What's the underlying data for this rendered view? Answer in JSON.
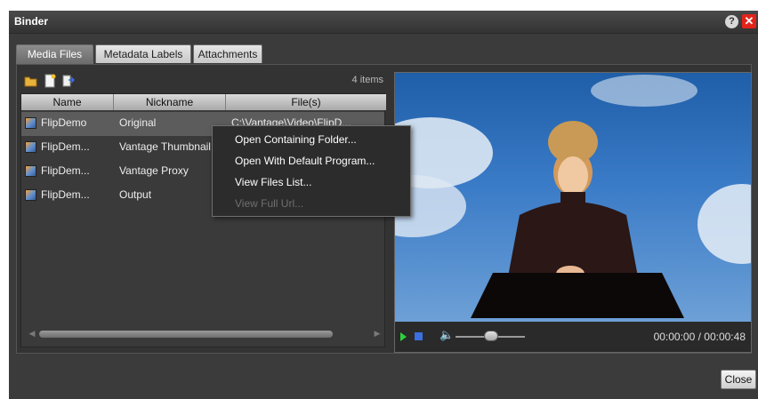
{
  "window": {
    "title": "Binder",
    "help_label": "?",
    "close_label": "✕"
  },
  "tabs": [
    {
      "label": "Media Files",
      "active": true
    },
    {
      "label": "Metadata Labels",
      "active": false
    },
    {
      "label": "Attachments",
      "active": false
    }
  ],
  "toolbar": {
    "icons": [
      "open-folder-icon",
      "new-document-icon",
      "export-icon"
    ],
    "items_count": "4 items"
  },
  "grid": {
    "columns": [
      "Name",
      "Nickname",
      "File(s)"
    ],
    "rows": [
      {
        "name": "FlipDemo",
        "nickname": "Original",
        "files": "C:\\Vantage\\Video\\FlipD..."
      },
      {
        "name": "FlipDem...",
        "nickname": "Vantage Thumbnail",
        "files": ""
      },
      {
        "name": "FlipDem...",
        "nickname": "Vantage Proxy",
        "files": ""
      },
      {
        "name": "FlipDem...",
        "nickname": "Output",
        "files": ""
      }
    ]
  },
  "context_menu": {
    "items": [
      {
        "label": "Open Containing Folder...",
        "enabled": true
      },
      {
        "label": "Open With Default Program...",
        "enabled": true
      },
      {
        "label": "View Files List...",
        "enabled": true
      },
      {
        "label": "View Full Url...",
        "enabled": false
      }
    ]
  },
  "player": {
    "timecode": "00:00:00 / 00:00:48",
    "volume_icon": "speaker-icon"
  },
  "footer": {
    "close_label": "Close"
  },
  "colors": {
    "close_x": "#e2241b",
    "play": "#2bd23a",
    "stop": "#3b6fe0"
  }
}
